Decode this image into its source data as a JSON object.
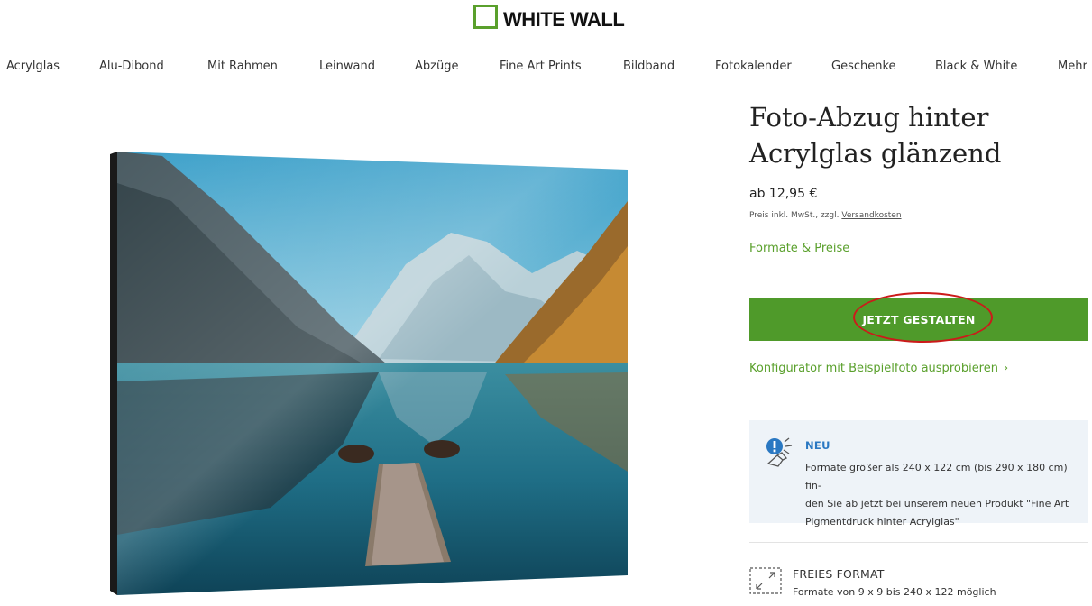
{
  "brand": {
    "logo_text": "WHITE WALL",
    "accent_color": "#5aa02c"
  },
  "nav": {
    "items": [
      {
        "label": "Acrylglas"
      },
      {
        "label": "Alu-Dibond"
      },
      {
        "label": "Mit Rahmen"
      },
      {
        "label": "Leinwand"
      },
      {
        "label": "Abzüge"
      },
      {
        "label": "Fine Art Prints"
      },
      {
        "label": "Bildband"
      },
      {
        "label": "Fotokalender"
      },
      {
        "label": "Geschenke"
      },
      {
        "label": "Black & White"
      },
      {
        "label": "Mehr"
      }
    ]
  },
  "product": {
    "image_icon": "acrylic-print-photo-mountain-lake",
    "title": "Foto-Abzug hinter Acrylglas glänzend",
    "price": "ab 12,95 €",
    "tax_note": "Preis inkl. MwSt., zzgl.",
    "shipping_link": "Versandkosten",
    "formats_link": "Formate & Preise",
    "cta_label": "JETZT GESTALTEN",
    "cta_color": "#4f9a2a",
    "highlight_color": "#cc1a1a",
    "config_link": "Konfigurator mit Beispielfoto ausprobieren",
    "config_chevron": "›"
  },
  "info_box": {
    "icon": "info-alert-icon",
    "heading": "NEU",
    "heading_color": "#2a78c2",
    "text": "Formate größer als 240 x 122 cm (bis 290 x 180 cm) finden Sie ab jetzt bei unserem neuen Produkt \"Fine Art Pigmentdruck hinter Acrylglas\"",
    "line1": "Formate größer als 240 x 122 cm (bis 290 x 180 cm) fin-",
    "line2": "den Sie ab jetzt bei unserem neuen Produkt \"Fine Art",
    "line3": "Pigmentdruck hinter Acrylglas\""
  },
  "feature": {
    "icon": "free-format-icon",
    "heading": "FREIES FORMAT",
    "text": "Formate von 9 x 9 bis 240 x 122 möglich"
  }
}
